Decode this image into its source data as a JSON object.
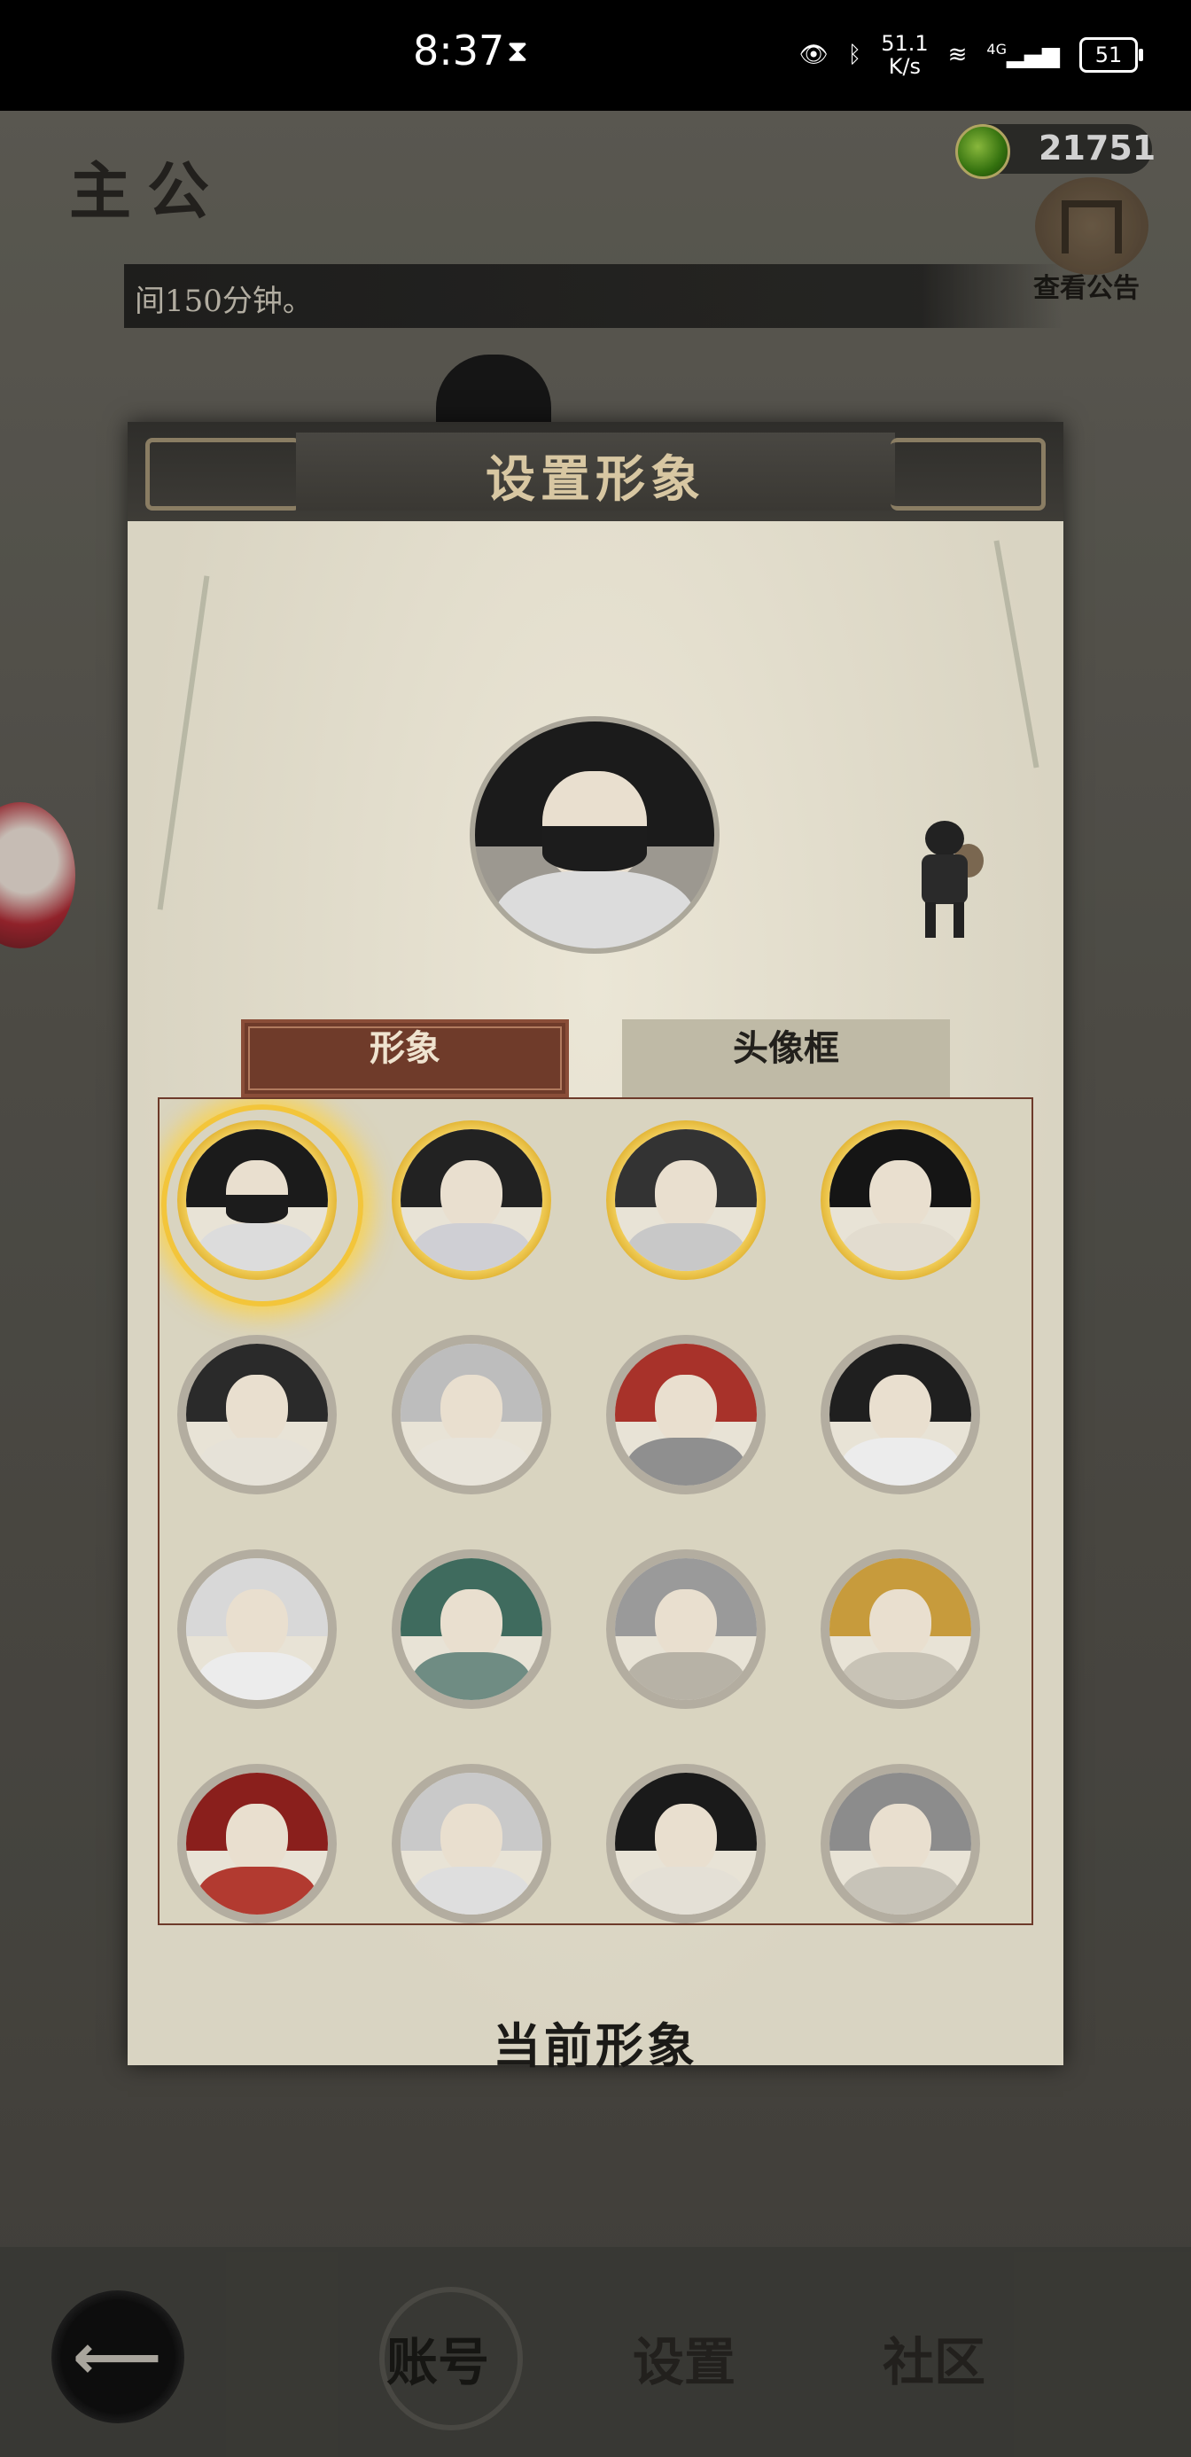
{
  "status_bar": {
    "time": "8:37",
    "speed_value": "51.1",
    "speed_unit": "K/s",
    "network": "4G",
    "battery": "51"
  },
  "background": {
    "page_title": "主公",
    "coin_balance": "21751",
    "notice_label": "查看公告",
    "marquee_text": "间150分钟。"
  },
  "modal": {
    "title": "设置形象",
    "tabs": [
      {
        "label": "形象",
        "active": true
      },
      {
        "label": "头像框",
        "active": false
      }
    ],
    "portraits": [
      {
        "icon": "masked-ninja-portrait-icon",
        "frame": "gold",
        "selected": true,
        "hair": "#1b1b1b",
        "body": "#dcdcdc"
      },
      {
        "icon": "young-general-portrait-icon",
        "frame": "gold",
        "selected": false,
        "hair": "#222",
        "body": "#cfcfd4"
      },
      {
        "icon": "long-hair-hero-portrait-icon",
        "frame": "gold",
        "selected": false,
        "hair": "#333",
        "body": "#c8c8c8"
      },
      {
        "icon": "lady-warrior-portrait-icon",
        "frame": "gold",
        "selected": false,
        "hair": "#151515",
        "body": "#e2dccf"
      },
      {
        "icon": "strategist-portrait-icon",
        "frame": "grey",
        "selected": false,
        "hair": "#2a2a2a",
        "body": "#e6e2d8"
      },
      {
        "icon": "elder-sage-portrait-icon",
        "frame": "grey",
        "selected": false,
        "hair": "#bdbdbd",
        "body": "#e8e4da"
      },
      {
        "icon": "red-bandana-warrior-portrait-icon",
        "frame": "grey",
        "selected": false,
        "hair": "#a8322a",
        "body": "#8f8f8f"
      },
      {
        "icon": "scholar-general-portrait-icon",
        "frame": "grey",
        "selected": false,
        "hair": "#1f1f1f",
        "body": "#ececec"
      },
      {
        "icon": "silver-helmet-general-portrait-icon",
        "frame": "grey",
        "selected": false,
        "hair": "#d8d8d8",
        "body": "#ececec"
      },
      {
        "icon": "green-robed-bearded-general-portrait-icon",
        "frame": "grey",
        "selected": false,
        "hair": "#3f6b5e",
        "body": "#6f8c83"
      },
      {
        "icon": "armored-veteran-portrait-icon",
        "frame": "grey",
        "selected": false,
        "hair": "#9a9a9a",
        "body": "#b7b2a6"
      },
      {
        "icon": "golden-helmet-general-portrait-icon",
        "frame": "grey",
        "selected": false,
        "hair": "#c79b3c",
        "body": "#c8c3b6"
      },
      {
        "icon": "crowned-warlord-portrait-icon",
        "frame": "grey",
        "selected": false,
        "hair": "#8a1f1c",
        "body": "#b23a30"
      },
      {
        "icon": "silver-masked-knight-portrait-icon",
        "frame": "grey",
        "selected": false,
        "hair": "#c9c9c9",
        "body": "#dedede"
      },
      {
        "icon": "young-noble-portrait-icon",
        "frame": "grey",
        "selected": false,
        "hair": "#1a1a1a",
        "body": "#e4e0d6"
      },
      {
        "icon": "steel-helmet-soldier-portrait-icon",
        "frame": "grey",
        "selected": false,
        "hair": "#8c8c8c",
        "body": "#c7c3b8"
      }
    ],
    "confirm_label": "当前形象"
  },
  "bottom_nav": {
    "items": [
      {
        "label": "账号",
        "active": true
      },
      {
        "label": "设置",
        "active": false
      },
      {
        "label": "社区",
        "active": false
      }
    ]
  },
  "colors": {
    "tab_active_bg": "#6f3b2a",
    "header_bg": "#2e2d2a",
    "gold_frame": "#f3c53a"
  }
}
